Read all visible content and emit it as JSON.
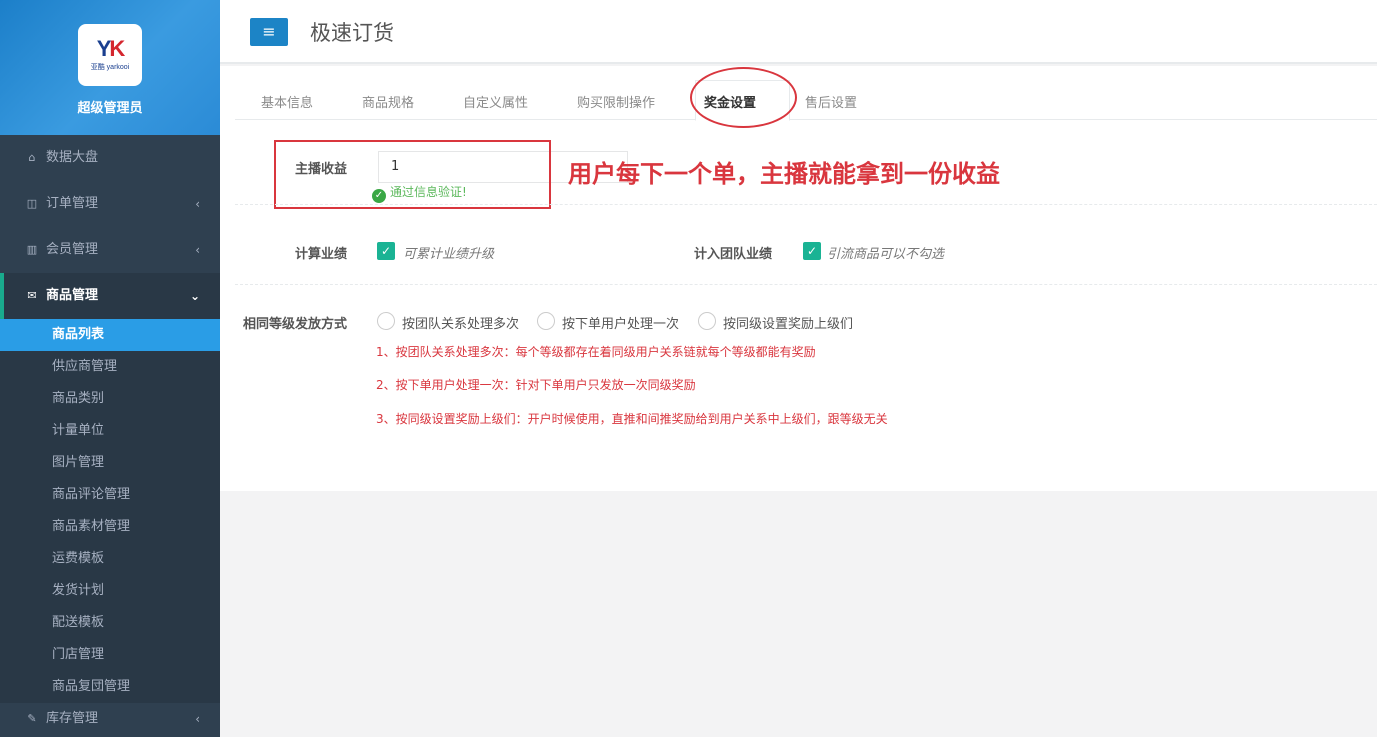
{
  "sidebar": {
    "logo_text": "YK",
    "logo_sub": "亚酷 yarkooi",
    "admin_name": "超级管理员",
    "menu": [
      {
        "label": "数据大盘",
        "icon": "home-icon",
        "arrow": ""
      },
      {
        "label": "订单管理",
        "icon": "columns-icon",
        "arrow": "‹"
      },
      {
        "label": "会员管理",
        "icon": "bar-chart-icon",
        "arrow": "‹"
      },
      {
        "label": "商品管理",
        "icon": "envelope-icon",
        "arrow": "⌄"
      }
    ],
    "submenu": [
      "商品列表",
      "供应商管理",
      "商品类别",
      "计量单位",
      "图片管理",
      "商品评论管理",
      "商品素材管理",
      "运费模板",
      "发货计划",
      "配送模板",
      "门店管理",
      "商品复団管理"
    ],
    "last_menu": {
      "label": "库存管理",
      "icon": "edit-icon",
      "arrow": "‹"
    }
  },
  "header": {
    "menu_button": "≡",
    "title": "极速订货"
  },
  "tabs": [
    "基本信息",
    "商品规格",
    "自定义属性",
    "购买限制操作",
    "奖金设置",
    "售后设置"
  ],
  "active_tab": "奖金设置",
  "form": {
    "anchor_income_label": "主播收益",
    "anchor_income_value": "1",
    "validation_msg": "通过信息验证!",
    "annotation": "用户每下一个单，主播就能拿到一份收益",
    "calc_perf_label": "计算业绩",
    "calc_perf_text": "可累计业绩升级",
    "team_perf_label": "计入团队业绩",
    "team_perf_text": "引流商品可以不勾选",
    "same_level_label": "相同等级发放方式",
    "radios": [
      "按团队关系处理多次",
      "按下单用户处理一次",
      "按同级设置奖励上级们"
    ],
    "notes": [
      "1、按团队关系处理多次：每个等级都存在着同级用户关系链就每个等级都能有奖励",
      "2、按下单用户处理一次：针对下单用户只发放一次同级奖励",
      "3、按同级设置奖励上级们：开户时候使用，直推和间推奖励给到用户关系中上级们，跟等级无关"
    ]
  },
  "colors": {
    "sidebar_bg": "#2f4050",
    "active_sub": "#2a9de6",
    "accent": "#1c84c6",
    "check": "#1ab394",
    "annotation_red": "#d9363e"
  }
}
